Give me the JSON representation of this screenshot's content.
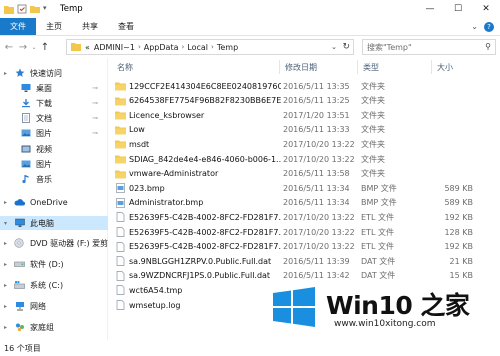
{
  "window": {
    "title": "Temp",
    "minimize": "—",
    "maximize": "☐",
    "close": "✕"
  },
  "ribbon": {
    "tabs": [
      "文件",
      "主页",
      "共享",
      "查看"
    ]
  },
  "address": {
    "prefix": "«",
    "crumbs": [
      "ADMINI~1",
      "AppData",
      "Local",
      "Temp"
    ]
  },
  "search": {
    "placeholder": "搜索\"Temp\""
  },
  "nav": {
    "quick_access": "快速访问",
    "desktop": "桌面",
    "downloads": "下载",
    "documents": "文档",
    "pictures1": "图片",
    "videos": "视频",
    "pictures2": "图片",
    "music": "音乐",
    "onedrive": "OneDrive",
    "this_pc": "此电脑",
    "dvd": "DVD 驱动器 (F:) 爱剪",
    "software": "软件 (D:)",
    "system": "系统 (C:)",
    "network": "网络",
    "homegroup": "家庭组"
  },
  "columns": {
    "name": "名称",
    "date": "修改日期",
    "type": "类型",
    "size": "大小"
  },
  "files": [
    {
      "name": "129CCF2E414304E6C8EE024081976CD...",
      "date": "2016/5/11 13:35",
      "type": "文件夹",
      "size": "",
      "icon": "folder"
    },
    {
      "name": "6264538FE7754F96B82F8230BB6E7EE...",
      "date": "2016/5/11 13:25",
      "type": "文件夹",
      "size": "",
      "icon": "folder"
    },
    {
      "name": "Licence_ksbrowser",
      "date": "2017/1/20 13:51",
      "type": "文件夹",
      "size": "",
      "icon": "folder"
    },
    {
      "name": "Low",
      "date": "2016/5/11 13:33",
      "type": "文件夹",
      "size": "",
      "icon": "folder"
    },
    {
      "name": "msdt",
      "date": "2017/10/20 13:22",
      "type": "文件夹",
      "size": "",
      "icon": "folder"
    },
    {
      "name": "SDIAG_842de4e4-e846-4060-b006-1...",
      "date": "2017/10/20 13:22",
      "type": "文件夹",
      "size": "",
      "icon": "folder"
    },
    {
      "name": "vmware-Administrator",
      "date": "2016/5/11 13:58",
      "type": "文件夹",
      "size": "",
      "icon": "folder"
    },
    {
      "name": "023.bmp",
      "date": "2016/5/11 13:34",
      "type": "BMP 文件",
      "size": "589 KB",
      "icon": "bmp"
    },
    {
      "name": "Administrator.bmp",
      "date": "2016/5/11 13:34",
      "type": "BMP 文件",
      "size": "589 KB",
      "icon": "bmp"
    },
    {
      "name": "E52639F5-C42B-4002-8FC2-FD281F7...",
      "date": "2017/10/20 13:22",
      "type": "ETL 文件",
      "size": "192 KB",
      "icon": "doc"
    },
    {
      "name": "E52639F5-C42B-4002-8FC2-FD281F7...",
      "date": "2017/10/20 13:22",
      "type": "ETL 文件",
      "size": "128 KB",
      "icon": "doc"
    },
    {
      "name": "E52639F5-C42B-4002-8FC2-FD281F7...",
      "date": "2017/10/20 13:22",
      "type": "ETL 文件",
      "size": "192 KB",
      "icon": "doc"
    },
    {
      "name": "sa.9NBLGGH1ZRPV.0.Public.Full.dat",
      "date": "2016/5/11 13:39",
      "type": "DAT 文件",
      "size": "21 KB",
      "icon": "doc"
    },
    {
      "name": "sa.9WZDNCRFJ1PS.0.Public.Full.dat",
      "date": "2016/5/11 13:42",
      "type": "DAT 文件",
      "size": "15 KB",
      "icon": "doc"
    },
    {
      "name": "wct6A54.tmp",
      "date": "",
      "type": "",
      "size": "",
      "icon": "doc"
    },
    {
      "name": "wmsetup.log",
      "date": "",
      "type": "",
      "size": "",
      "icon": "doc"
    }
  ],
  "status": {
    "count": "16 个项目"
  },
  "watermark": {
    "brand": "Win10 之家",
    "url": "www.win10xitong.com"
  },
  "colors": {
    "accent": "#1979ca",
    "folder": "#f3c74b",
    "selected": "#cce8ff",
    "win_logo": "#1a8fe0"
  }
}
